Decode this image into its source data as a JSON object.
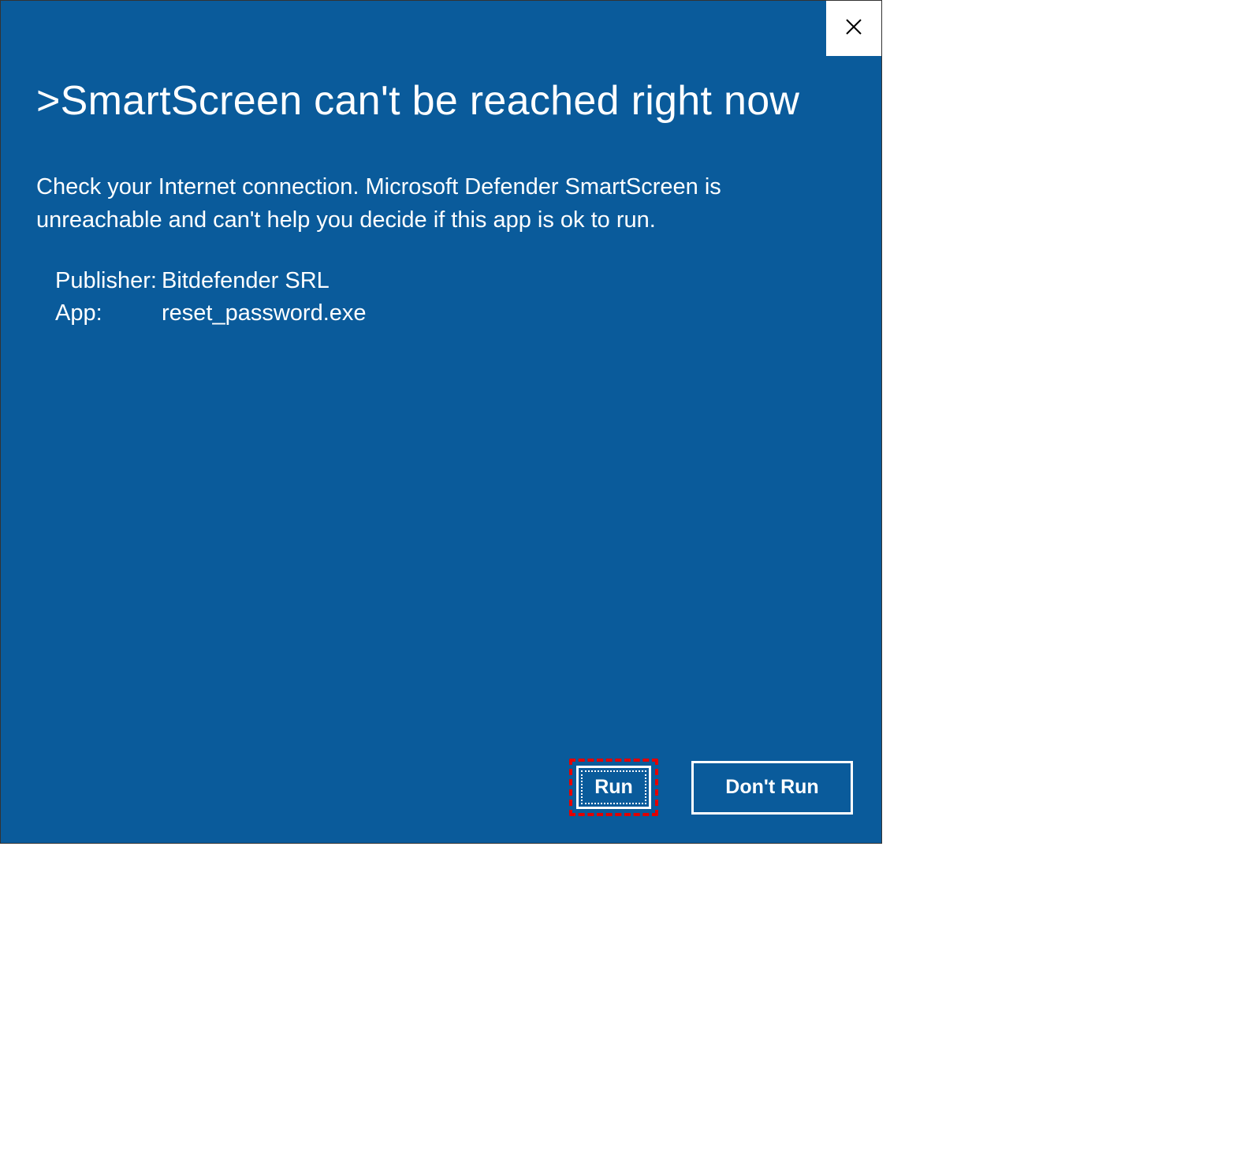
{
  "dialog": {
    "title_prefix": ">",
    "title": "SmartScreen can't be reached right now",
    "body": "Check your Internet connection. Microsoft Defender SmartScreen is unreachable and can't help you decide if this app is ok to run.",
    "details": {
      "publisher_label": "Publisher:",
      "publisher_value": "Bitdefender SRL",
      "app_label": "App:",
      "app_value": "reset_password.exe"
    },
    "buttons": {
      "run": "Run",
      "dont_run": "Don't Run"
    }
  }
}
